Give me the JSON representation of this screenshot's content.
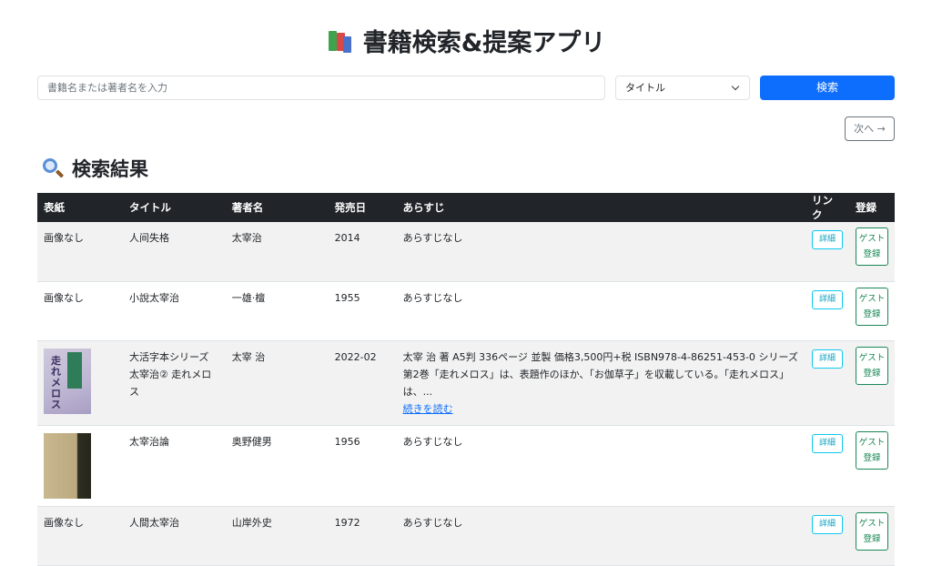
{
  "header": {
    "title": "書籍検索&提案アプリ"
  },
  "search": {
    "placeholder": "書籍名または著者名を入力",
    "value": "",
    "mode_selected": "タイトル",
    "search_label": "検索"
  },
  "pagination": {
    "next_label": "次へ →"
  },
  "results": {
    "heading": "検索結果",
    "columns": [
      "表紙",
      "タイトル",
      "著者名",
      "発売日",
      "あらすじ",
      "リンク",
      "登録"
    ],
    "detail_label": "詳細",
    "guest_label": "ゲスト登録",
    "read_more_label": "続きを読む",
    "rows": [
      {
        "cover": "画像なし",
        "title": "人间失格",
        "author": "太宰治",
        "date": "2014",
        "synopsis": "あらすじなし"
      },
      {
        "cover": "画像なし",
        "title": "小說太宰治",
        "author": "一雄·檀",
        "date": "1955",
        "synopsis": "あらすじなし"
      },
      {
        "cover": "",
        "cover_text": "走れメロス",
        "title": "大活字本シリーズ 太宰治② 走れメロス",
        "author": "太宰 治",
        "date": "2022-02",
        "synopsis": "太宰 治 著 A5判 336ページ 並製 価格3,500円+税 ISBN978-4-86251-453-0 シリーズ第2巻「走れメロス」は、表題作のほか、「お伽草子」を収載している。「走れメロス」は、..."
      },
      {
        "cover": "",
        "title": "太宰治論",
        "author": "奥野健男",
        "date": "1956",
        "synopsis": "あらすじなし"
      },
      {
        "cover": "画像なし",
        "title": "人間太宰治",
        "author": "山岸外史",
        "date": "1972",
        "synopsis": "あらすじなし"
      }
    ]
  },
  "colors": {
    "primary": "#0d6efd",
    "header_bg": "#212529",
    "info": "#0dcaf0",
    "success": "#198754"
  }
}
